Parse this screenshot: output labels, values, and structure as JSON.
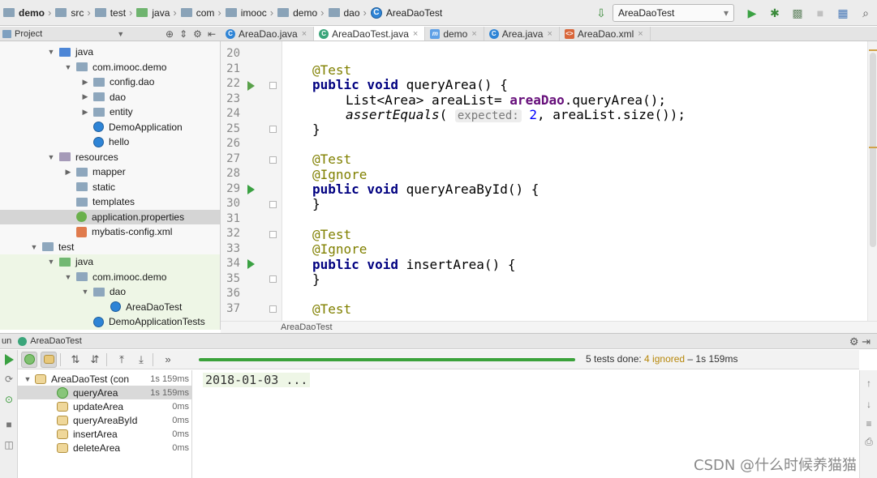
{
  "breadcrumb": [
    {
      "label": "demo",
      "icon": "folder-icon",
      "bold": true
    },
    {
      "label": "src",
      "icon": "folder-icon"
    },
    {
      "label": "test",
      "icon": "folder-icon"
    },
    {
      "label": "java",
      "icon": "source-folder-icon"
    },
    {
      "label": "com",
      "icon": "package-icon"
    },
    {
      "label": "imooc",
      "icon": "package-icon"
    },
    {
      "label": "demo",
      "icon": "package-icon"
    },
    {
      "label": "dao",
      "icon": "package-icon"
    },
    {
      "label": "AreaDaoTest",
      "icon": "class-icon"
    }
  ],
  "run_config": {
    "selected": "AreaDaoTest"
  },
  "project_panel": {
    "title": "Project"
  },
  "editor_tabs": [
    {
      "label": "AreaDao.java",
      "icon": "class",
      "active": false
    },
    {
      "label": "AreaDaoTest.java",
      "icon": "test",
      "active": true
    },
    {
      "label": "demo",
      "icon": "m",
      "active": false
    },
    {
      "label": "Area.java",
      "icon": "class",
      "active": false
    },
    {
      "label": "AreaDao.xml",
      "icon": "xml",
      "active": false
    }
  ],
  "project_tree": [
    {
      "label": "java",
      "indent": 1,
      "arrow": "down",
      "icon": "fblue"
    },
    {
      "label": "com.imooc.demo",
      "indent": 2,
      "arrow": "down",
      "icon": "fgray"
    },
    {
      "label": "config.dao",
      "indent": 3,
      "arrow": "right",
      "icon": "fgray"
    },
    {
      "label": "dao",
      "indent": 3,
      "arrow": "right",
      "icon": "fgray"
    },
    {
      "label": "entity",
      "indent": 3,
      "arrow": "right",
      "icon": "fgray"
    },
    {
      "label": "DemoApplication",
      "indent": 3,
      "arrow": "",
      "icon": "cls"
    },
    {
      "label": "hello",
      "indent": 3,
      "arrow": "",
      "icon": "cls"
    },
    {
      "label": "resources",
      "indent": 1,
      "arrow": "down",
      "icon": "fres"
    },
    {
      "label": "mapper",
      "indent": 2,
      "arrow": "right",
      "icon": "fgray"
    },
    {
      "label": "static",
      "indent": 2,
      "arrow": "",
      "icon": "fgray"
    },
    {
      "label": "templates",
      "indent": 2,
      "arrow": "",
      "icon": "fgray"
    },
    {
      "label": "application.properties",
      "indent": 2,
      "arrow": "",
      "icon": "spring",
      "selected": true
    },
    {
      "label": "mybatis-config.xml",
      "indent": 2,
      "arrow": "",
      "icon": "xml"
    },
    {
      "label": "test",
      "indent": 0,
      "arrow": "down",
      "icon": "fgray"
    },
    {
      "label": "java",
      "indent": 1,
      "arrow": "down",
      "icon": "fgreen",
      "testbg": true
    },
    {
      "label": "com.imooc.demo",
      "indent": 2,
      "arrow": "down",
      "icon": "fgray",
      "testbg": true
    },
    {
      "label": "dao",
      "indent": 3,
      "arrow": "down",
      "icon": "fgray",
      "testbg": true
    },
    {
      "label": "AreaDaoTest",
      "indent": 4,
      "arrow": "",
      "icon": "cls",
      "testbg": true
    },
    {
      "label": "DemoApplicationTests",
      "indent": 3,
      "arrow": "",
      "icon": "cls",
      "testbg": true
    }
  ],
  "editor": {
    "line_numbers": [
      "20",
      "21",
      "22",
      "23",
      "24",
      "25",
      "26",
      "27",
      "28",
      "29",
      "30",
      "31",
      "32",
      "33",
      "34",
      "35",
      "36",
      "37"
    ],
    "lines": {
      "l21": "@Test",
      "l22_kw": "public void",
      "l22_rest": " queryArea() {",
      "l23_type": "List<Area> areaList= ",
      "l23_field": "areaDao",
      "l23_rest": ".queryArea();",
      "l24_call": "assertEquals",
      "l24_paren": "( ",
      "l24_hint": "expected:",
      "l24_num": " 2",
      "l24_rest": ", areaList.size());",
      "l25": "}",
      "l27": "@Test",
      "l28": "@Ignore",
      "l29_kw": "public void",
      "l29_rest": " queryAreaById() {",
      "l30": "}",
      "l32": "@Test",
      "l33": "@Ignore",
      "l34_kw": "public void",
      "l34_rest": " insertArea() {",
      "l35": "}",
      "l37": "@Test"
    },
    "breadcrumb_label": "AreaDaoTest"
  },
  "run_panel": {
    "label": "Run",
    "tab_title": "AreaDaoTest",
    "status_prefix": "5 tests done: ",
    "status_ignored": "4 ignored",
    "status_suffix": " – 1s 159ms",
    "progress": 1.0,
    "progress_color": "#3ba23b"
  },
  "test_results": [
    {
      "name": "AreaDaoTest (con",
      "time": "1s 159ms",
      "status": "ignored",
      "level": 0,
      "arrow": "down"
    },
    {
      "name": "queryArea",
      "time": "1s 159ms",
      "status": "passed",
      "level": 1,
      "selected": true
    },
    {
      "name": "updateArea",
      "time": "0ms",
      "status": "ignored",
      "level": 1
    },
    {
      "name": "queryAreaById",
      "time": "0ms",
      "status": "ignored",
      "level": 1
    },
    {
      "name": "insertArea",
      "time": "0ms",
      "status": "ignored",
      "level": 1
    },
    {
      "name": "deleteArea",
      "time": "0ms",
      "status": "ignored",
      "level": 1
    }
  ],
  "console": {
    "output": "2018-01-03 ..."
  },
  "watermark": "CSDN @什么时候养猫猫",
  "colors": {
    "annotation": "#808000",
    "keyword": "#000080",
    "field": "#660e7a",
    "pass": "#3ba23b",
    "ignored": "#b7870a"
  }
}
